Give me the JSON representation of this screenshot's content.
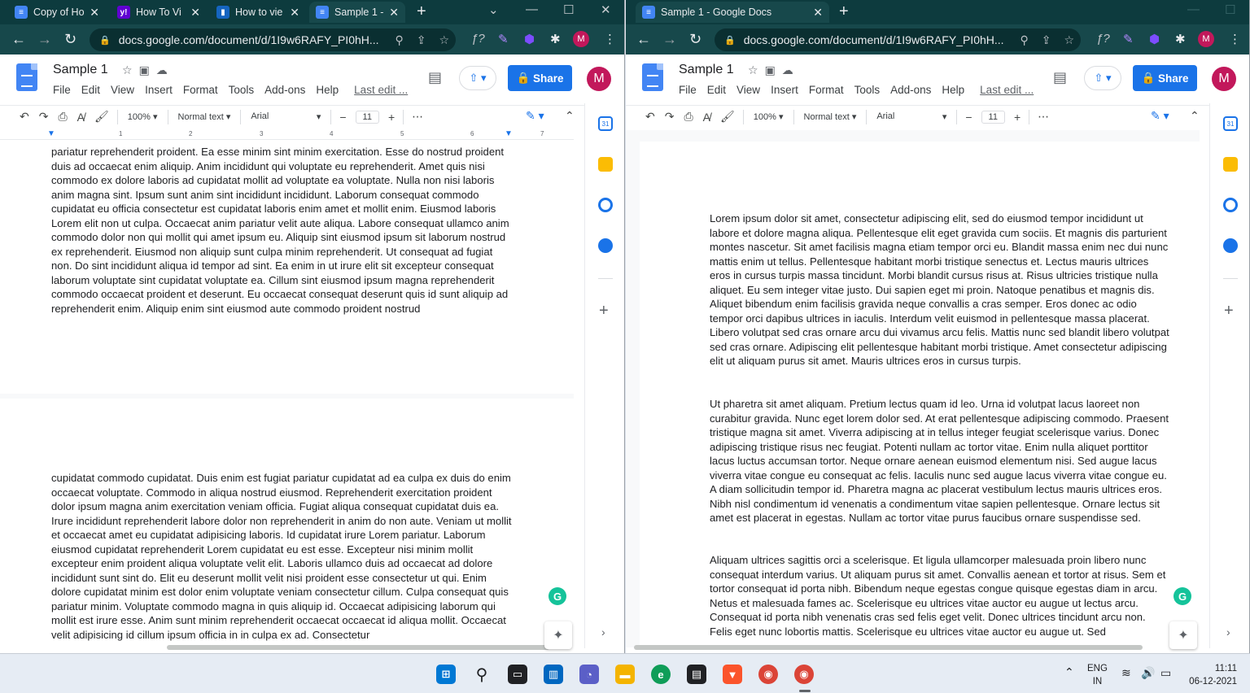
{
  "left_window": {
    "tabs": [
      {
        "title": "Copy of Ho",
        "color": "#4285f4",
        "glyph": "≡"
      },
      {
        "title": "How To Vi",
        "color": "#6001d2",
        "glyph": "y!"
      },
      {
        "title": "How to vie",
        "color": "#1565c0",
        "glyph": "▮"
      },
      {
        "title": "Sample 1 -",
        "color": "#4285f4",
        "glyph": "≡"
      }
    ],
    "url": "docs.google.com/document/d/1I9w6RAFY_PI0hH...",
    "zoom": "100%",
    "style": "Normal text",
    "font": "Arial",
    "font_size": "11",
    "ruler": [
      "1",
      "2",
      "3",
      "4",
      "5",
      "6",
      "7"
    ],
    "page1_text": "pariatur reprehenderit proident. Ea esse minim sint minim exercitation. Esse do nostrud proident duis ad occaecat enim aliquip. Anim incididunt qui voluptate eu reprehenderit. Amet quis nisi commodo ex dolore laboris ad cupidatat mollit ad voluptate ea voluptate. Nulla non nisi laboris anim magna sint. Ipsum sunt anim sint incididunt incididunt. Laborum consequat commodo cupidatat eu officia consectetur est cupidatat laboris enim amet et mollit enim. Eiusmod laboris Lorem elit non ut culpa. Occaecat anim pariatur velit aute aliqua. Labore consequat ullamco anim commodo dolor non qui mollit qui amet ipsum eu. Aliquip sint eiusmod ipsum sit laborum nostrud ex reprehenderit. Eiusmod non aliquip sunt culpa minim reprehenderit. Ut consequat ad fugiat non. Do sint incididunt aliqua id tempor ad sint. Ea enim in ut irure elit sit excepteur consequat laborum voluptate sint cupidatat voluptate ea. Cillum sint eiusmod ipsum magna reprehenderit commodo occaecat proident et deserunt. Eu occaecat consequat deserunt quis id sunt aliquip ad reprehenderit enim. Aliquip enim sint eiusmod aute commodo proident nostrud",
    "page2_text": "cupidatat commodo cupidatat. Duis enim est fugiat pariatur cupidatat ad ea culpa ex duis do enim occaecat voluptate. Commodo in aliqua nostrud eiusmod. Reprehenderit exercitation proident dolor ipsum magna anim exercitation veniam officia. Fugiat aliqua consequat cupidatat duis ea. Irure incididunt reprehenderit labore dolor non reprehenderit in anim do non aute. Veniam ut mollit et occaecat amet eu cupidatat adipisicing laboris. Id cupidatat irure Lorem pariatur. Laborum eiusmod cupidatat reprehenderit Lorem cupidatat eu est esse. Excepteur nisi minim mollit excepteur enim proident aliqua voluptate velit elit. Laboris ullamco duis ad occaecat ad dolore incididunt sunt sint do. Elit eu deserunt mollit velit nisi proident esse consectetur ut qui. Enim dolore cupidatat minim est dolor enim voluptate veniam consectetur cillum. Culpa consequat quis pariatur minim. Voluptate commodo magna in quis aliquip id. Occaecat adipisicing laborum qui mollit est irure esse. Anim sunt minim reprehenderit occaecat occaecat id aliqua mollit. Occaecat velit adipisicing id cillum ipsum officia in in culpa ex ad. Consectetur"
  },
  "right_window": {
    "tabs": [
      {
        "title": "Sample 1 - Google Docs",
        "color": "#4285f4",
        "glyph": "≡"
      }
    ],
    "url": "docs.google.com/document/d/1I9w6RAFY_PI0hH...",
    "zoom": "100%",
    "style": "Normal text",
    "font": "Arial",
    "font_size": "11",
    "para1": "Lorem ipsum dolor sit amet, consectetur adipiscing elit, sed do eiusmod tempor incididunt ut labore et dolore magna aliqua. Pellentesque elit eget gravida cum sociis. Et magnis dis parturient montes nascetur. Sit amet facilisis magna etiam tempor orci eu. Blandit massa enim nec dui nunc mattis enim ut tellus. Pellentesque habitant morbi tristique senectus et. Lectus mauris ultrices eros in cursus turpis massa tincidunt. Morbi blandit cursus risus at. Risus ultricies tristique nulla aliquet. Eu sem integer vitae justo. Dui sapien eget mi proin. Natoque penatibus et magnis dis. Aliquet bibendum enim facilisis gravida neque convallis a cras semper. Eros donec ac odio tempor orci dapibus ultrices in iaculis. Interdum velit euismod in pellentesque massa placerat. Libero volutpat sed cras ornare arcu dui vivamus arcu felis. Mattis nunc sed blandit libero volutpat sed cras ornare. Adipiscing elit pellentesque habitant morbi tristique. Amet consectetur adipiscing elit ut aliquam purus sit amet. Mauris ultrices eros in cursus turpis.",
    "para2": "Ut pharetra sit amet aliquam. Pretium lectus quam id leo. Urna id volutpat lacus laoreet non curabitur gravida. Nunc eget lorem dolor sed. At erat pellentesque adipiscing commodo. Praesent tristique magna sit amet. Viverra adipiscing at in tellus integer feugiat scelerisque varius. Donec adipiscing tristique risus nec feugiat. Potenti nullam ac tortor vitae. Enim nulla aliquet porttitor lacus luctus accumsan tortor. Neque ornare aenean euismod elementum nisi. Sed augue lacus viverra vitae congue eu consequat ac felis. Iaculis nunc sed augue lacus viverra vitae congue eu. A diam sollicitudin tempor id. Pharetra magna ac placerat vestibulum lectus mauris ultrices eros. Nibh nisl condimentum id venenatis a condimentum vitae sapien pellentesque. Ornare lectus sit amet est placerat in egestas. Nullam ac tortor vitae purus faucibus ornare suspendisse sed.",
    "para3": "Aliquam ultrices sagittis orci a scelerisque. Et ligula ullamcorper malesuada proin libero nunc consequat interdum varius. Ut aliquam purus sit amet. Convallis aenean et tortor at risus. Sem et tortor consequat id porta nibh. Bibendum neque egestas congue quisque egestas diam in arcu. Netus et malesuada fames ac. Scelerisque eu ultrices vitae auctor eu augue ut lectus arcu. Consequat id porta nibh venenatis cras sed felis eget velit. Donec ultrices tincidunt arcu non. Felis eget nunc lobortis mattis. Scelerisque eu ultrices vitae auctor eu augue ut. Sed"
  },
  "doc": {
    "title": "Sample 1",
    "menu": [
      "File",
      "Edit",
      "View",
      "Insert",
      "Format",
      "Tools",
      "Add-ons",
      "Help"
    ],
    "last_edit": "Last edit ...",
    "share": "Share",
    "avatar": "M",
    "calendar_day": "31"
  },
  "taskbar": {
    "lang1": "ENG",
    "lang2": "IN",
    "time": "11:11",
    "date": "06-12-2021"
  }
}
